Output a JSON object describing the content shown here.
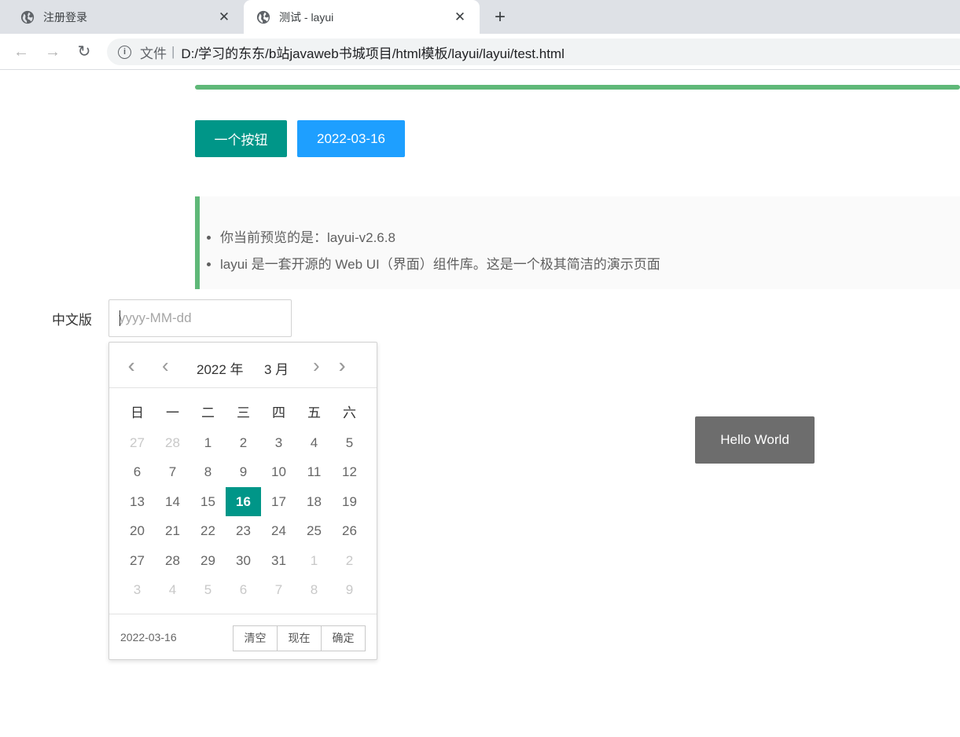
{
  "browser": {
    "tabs": [
      {
        "title": "注册登录",
        "active": false,
        "icon": "globe-icon"
      },
      {
        "title": "测试 - layui",
        "active": true,
        "icon": "globe-icon"
      }
    ],
    "close_glyph": "✕",
    "new_tab_glyph": "+",
    "nav": {
      "back": "←",
      "forward": "→",
      "reload": "↻"
    },
    "address": {
      "info_glyph": "i",
      "scheme_label": "文件",
      "separator": "|",
      "url": "D:/学习的东东/b站javaweb书城项目/html模板/layui/layui/test.html"
    }
  },
  "page": {
    "progress": {
      "percent": 100,
      "color": "#5fb878"
    },
    "buttons": {
      "primary_label": "一个按钮",
      "date_label": "2022-03-16"
    },
    "quote": {
      "items": [
        "你当前预览的是：layui-v2.6.8",
        "layui 是一套开源的 Web UI（界面）组件库。这是一个极其简洁的演示页面"
      ]
    },
    "form": {
      "label": "中文版",
      "placeholder": "yyyy-MM-dd",
      "value": ""
    },
    "hello_label": "Hello World"
  },
  "laydate": {
    "nav_glyphs": {
      "prev_year": "‹‹",
      "prev_month": "‹",
      "next_month": "›",
      "next_year": "››"
    },
    "year_label": "2022 年",
    "month_label": "3 月",
    "weekdays": [
      "日",
      "一",
      "二",
      "三",
      "四",
      "五",
      "六"
    ],
    "weeks": [
      [
        {
          "d": "27",
          "o": true
        },
        {
          "d": "28",
          "o": true
        },
        {
          "d": "1"
        },
        {
          "d": "2"
        },
        {
          "d": "3"
        },
        {
          "d": "4"
        },
        {
          "d": "5"
        }
      ],
      [
        {
          "d": "6"
        },
        {
          "d": "7"
        },
        {
          "d": "8"
        },
        {
          "d": "9"
        },
        {
          "d": "10"
        },
        {
          "d": "11"
        },
        {
          "d": "12"
        }
      ],
      [
        {
          "d": "13"
        },
        {
          "d": "14"
        },
        {
          "d": "15"
        },
        {
          "d": "16",
          "s": true
        },
        {
          "d": "17"
        },
        {
          "d": "18"
        },
        {
          "d": "19"
        }
      ],
      [
        {
          "d": "20"
        },
        {
          "d": "21"
        },
        {
          "d": "22"
        },
        {
          "d": "23"
        },
        {
          "d": "24"
        },
        {
          "d": "25"
        },
        {
          "d": "26"
        }
      ],
      [
        {
          "d": "27"
        },
        {
          "d": "28"
        },
        {
          "d": "29"
        },
        {
          "d": "30"
        },
        {
          "d": "31"
        },
        {
          "d": "1",
          "o": true
        },
        {
          "d": "2",
          "o": true
        }
      ],
      [
        {
          "d": "3",
          "o": true
        },
        {
          "d": "4",
          "o": true
        },
        {
          "d": "5",
          "o": true
        },
        {
          "d": "6",
          "o": true
        },
        {
          "d": "7",
          "o": true
        },
        {
          "d": "8",
          "o": true
        },
        {
          "d": "9",
          "o": true
        }
      ]
    ],
    "footer": {
      "selected_date": "2022-03-16",
      "clear_label": "清空",
      "now_label": "现在",
      "confirm_label": "确定"
    },
    "accent_color": "#009688"
  }
}
